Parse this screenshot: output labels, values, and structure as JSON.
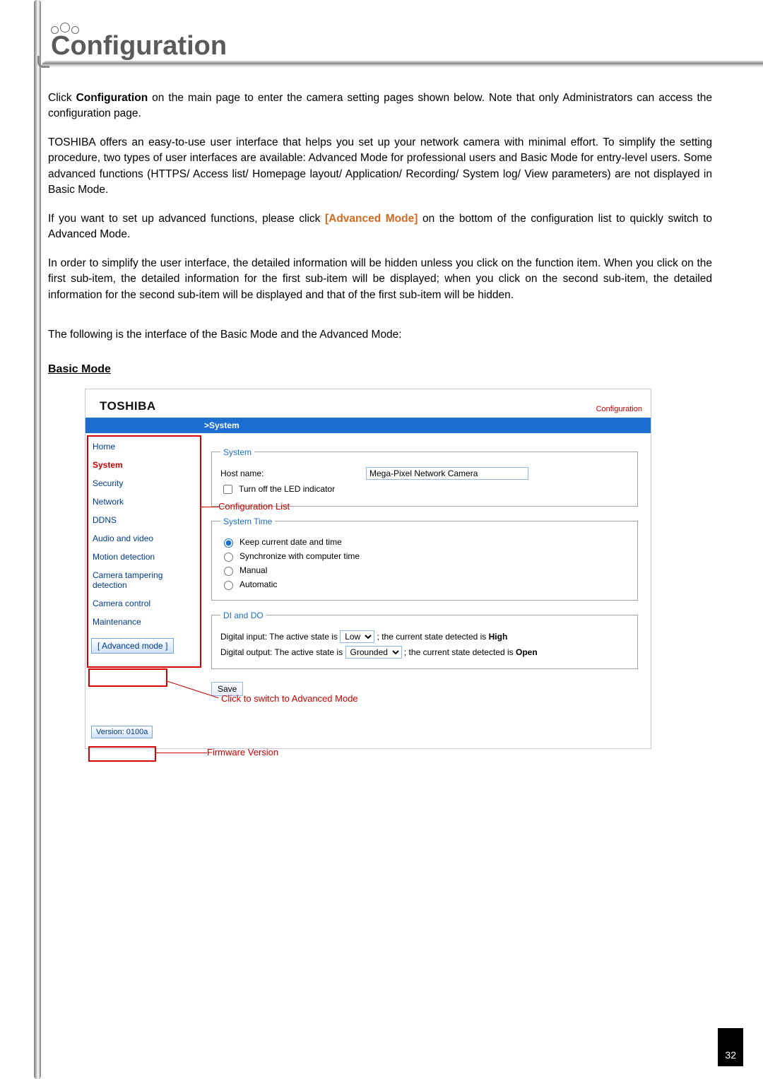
{
  "page": {
    "title": "Configuration",
    "number": "32"
  },
  "paragraphs": {
    "p1_a": "Click ",
    "p1_b": "Configuration",
    "p1_c": " on the main page to enter the camera setting pages shown below. Note that only Administrators can access the configuration page.",
    "p2": "TOSHIBA offers an easy-to-use user interface that helps you set up your network camera with minimal effort. To simplify the setting procedure, two types of user interfaces are available: Advanced Mode for professional users and Basic Mode for entry-level users. Some advanced functions (HTTPS/ Access list/ Homepage layout/ Application/ Recording/ System log/ View parameters) are not displayed in Basic Mode.",
    "p3_a": "If you want to set up advanced functions, please click ",
    "p3_b": "[Advanced Mode]",
    "p3_c": " on the bottom of the configuration list to quickly switch to Advanced Mode.",
    "p4": "In order to simplify the user interface, the detailed information will be hidden unless you click on the function item. When you click on the first sub-item, the detailed information for the first sub-item will be displayed; when you click on the second sub-item, the detailed information for the second sub-item will be displayed and that of the first sub-item will be hidden.",
    "p5": "The following is the interface of the Basic Mode and the Advanced Mode:"
  },
  "mode_heading": "Basic Mode",
  "ui": {
    "brand": "TOSHIBA",
    "config_link": "Configuration",
    "bluebar": ">System",
    "sidebar": [
      "Home",
      "System",
      "Security",
      "Network",
      "DDNS",
      "Audio and video",
      "Motion detection",
      "Camera tampering detection",
      "Camera control",
      "Maintenance"
    ],
    "advanced_btn": "[ Advanced mode ]",
    "version": "Version: 0100a",
    "sections": {
      "system": {
        "legend": "System",
        "hostname_label": "Host name:",
        "hostname_value": "Mega-Pixel Network Camera",
        "led_label": "Turn off the LED indicator"
      },
      "systime": {
        "legend": "System Time",
        "opt_keep": "Keep current date and time",
        "opt_sync": "Synchronize with computer time",
        "opt_manual": "Manual",
        "opt_auto": "Automatic"
      },
      "dido": {
        "legend": "DI and DO",
        "di_a": "Digital input: The active state is ",
        "di_sel": "Low",
        "di_b": " ; the current state detected is ",
        "di_c": "High",
        "do_a": "Digital output: The active state is ",
        "do_sel": "Grounded",
        "do_b": " ; the current state detected is ",
        "do_c": "Open"
      },
      "save": "Save"
    },
    "callouts": {
      "conf_list": "Configuration List",
      "switch": "Click to switch to Advanced Mode",
      "fw": "Firmware Version"
    }
  }
}
